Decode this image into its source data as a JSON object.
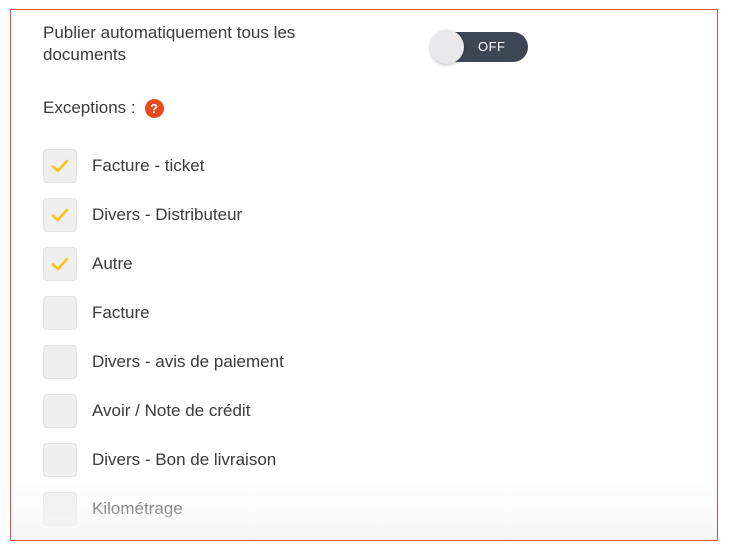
{
  "auto_publish": {
    "label": "Publier automatiquement tous les documents",
    "toggle_state": "OFF"
  },
  "exceptions": {
    "label": "Exceptions :",
    "help_icon": "?"
  },
  "document_types": [
    {
      "label": "Facture - ticket",
      "checked": true
    },
    {
      "label": "Divers - Distributeur",
      "checked": true
    },
    {
      "label": "Autre",
      "checked": true
    },
    {
      "label": "Facture",
      "checked": false
    },
    {
      "label": "Divers - avis de paiement",
      "checked": false
    },
    {
      "label": "Avoir / Note de crédit",
      "checked": false
    },
    {
      "label": "Divers - Bon de livraison",
      "checked": false
    },
    {
      "label": "Kilométrage",
      "checked": false
    }
  ],
  "colors": {
    "border": "#e0524a",
    "toggle_bg": "#3d4654",
    "check": "#f5c518",
    "help_icon": "#e8491d"
  },
  "icons": {
    "check": "checkmark-icon",
    "help": "question-mark-icon"
  }
}
